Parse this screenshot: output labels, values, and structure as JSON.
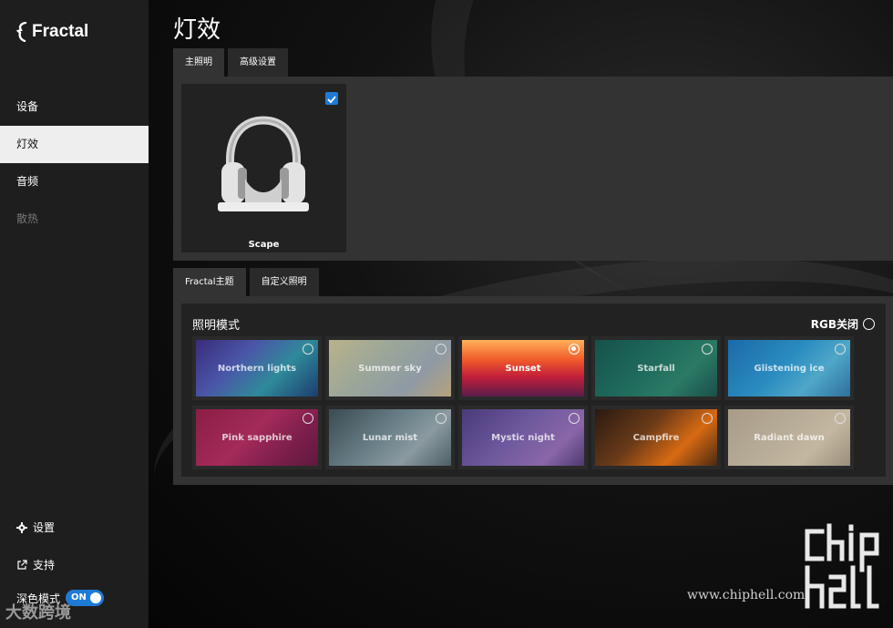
{
  "app": {
    "brand": "Fractal"
  },
  "sidebar": {
    "items": [
      {
        "label": "设备",
        "state": "normal"
      },
      {
        "label": "灯效",
        "state": "active"
      },
      {
        "label": "音频",
        "state": "normal"
      },
      {
        "label": "散热",
        "state": "disabled"
      }
    ],
    "settings_label": "设置",
    "support_label": "支持",
    "dark_mode_label": "深色模式",
    "dark_mode_toggle": "ON"
  },
  "page": {
    "title": "灯效"
  },
  "top_tabs": [
    {
      "label": "主照明",
      "active": true
    },
    {
      "label": "高级设置",
      "active": false
    }
  ],
  "device": {
    "name": "Scape",
    "checked": true
  },
  "theme_tabs": [
    {
      "label": "Fractal主题",
      "active": true
    },
    {
      "label": "自定义照明",
      "active": false
    }
  ],
  "lighting": {
    "mode_label": "照明模式",
    "rgb_off_label": "RGB关闭",
    "themes": [
      {
        "name": "Northern lights",
        "selected": false,
        "gradient": "linear-gradient(135deg,#3a2b7a 0%,#4a56a8 35%,#2f8a9a 65%,#1c3d6d 100%)"
      },
      {
        "name": "Summer sky",
        "selected": false,
        "gradient": "linear-gradient(135deg,#b9b28a 0%,#9aa69a 40%,#8f9aa4 70%,#b6a27c 100%)"
      },
      {
        "name": "Sunset",
        "selected": true,
        "gradient": "linear-gradient(180deg,#ffb15a 0%,#f05a2a 35%,#c21f3a 65%,#5a1d4a 100%)"
      },
      {
        "name": "Starfall",
        "selected": false,
        "gradient": "linear-gradient(135deg,#16514b 0%,#1f6b5c 45%,#2b7a66 70%,#1a4f49 100%)"
      },
      {
        "name": "Glistening ice",
        "selected": false,
        "gradient": "linear-gradient(135deg,#1c6aa8 0%,#2a8cc0 45%,#4fa7c8 70%,#2e6f9c 100%)"
      },
      {
        "name": "Pink sapphire",
        "selected": false,
        "gradient": "linear-gradient(135deg,#8a1e45 0%,#a42a5a 45%,#7a1e4a 75%,#5e1a3c 100%)"
      },
      {
        "name": "Lunar mist",
        "selected": false,
        "gradient": "linear-gradient(135deg,#3b4b52 0%,#6a8088 45%,#8a9aa0 70%,#4d5f66 100%)"
      },
      {
        "name": "Mystic night",
        "selected": false,
        "gradient": "linear-gradient(135deg,#4a3a7a 0%,#6e5a9e 45%,#8a66a8 75%,#4c3a70 100%)"
      },
      {
        "name": "Campfire",
        "selected": false,
        "gradient": "linear-gradient(135deg,#2a1a12 0%,#6a3a18 40%,#d86a12 70%,#4a2a14 100%)"
      },
      {
        "name": "Radiant dawn",
        "selected": false,
        "gradient": "linear-gradient(135deg,#a89c88 0%,#b8ad98 45%,#c4b7a0 70%,#9a8f7c 100%)"
      }
    ]
  },
  "watermark": {
    "url": "www.chiphell.com",
    "bottom_left": "大数跨境"
  },
  "colors": {
    "accent": "#1f7ad6",
    "sidebar_bg": "#1e1e1e",
    "panel_bg": "#333333"
  }
}
